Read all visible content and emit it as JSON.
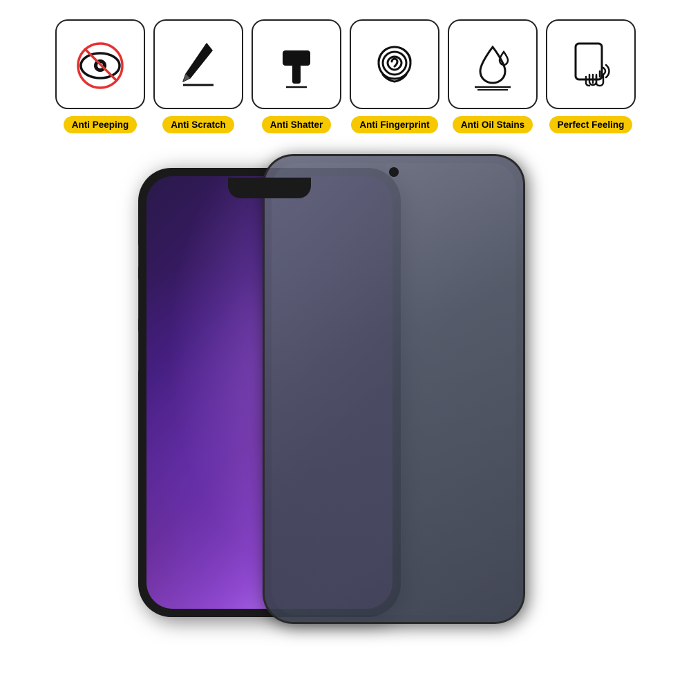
{
  "features": [
    {
      "id": "anti-peeping",
      "label": "Anti Peeping",
      "icon": "eye-slash"
    },
    {
      "id": "anti-scratch",
      "label": "Anti Scratch",
      "icon": "pen-slash"
    },
    {
      "id": "anti-shatter",
      "label": "Anti Shatter",
      "icon": "hammer"
    },
    {
      "id": "anti-fingerprint",
      "label": "Anti Fingerprint",
      "icon": "fingerprint"
    },
    {
      "id": "anti-oil",
      "label": "Anti Oil Stains",
      "icon": "water-drop"
    },
    {
      "id": "perfect-feeling",
      "label": "Perfect Feeling",
      "icon": "touch"
    }
  ],
  "accent_color": "#f5c800"
}
